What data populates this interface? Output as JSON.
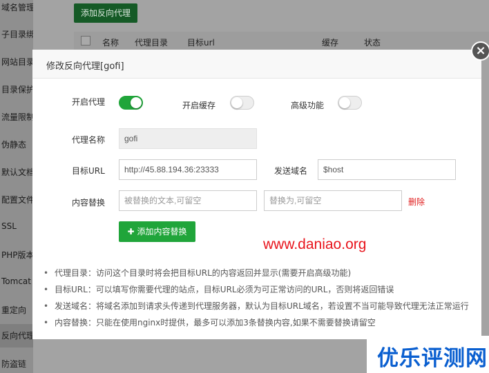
{
  "sidebar": {
    "items": [
      {
        "label": "域名管理"
      },
      {
        "label": "子目录绑定"
      },
      {
        "label": "网站目录"
      },
      {
        "label": "目录保护"
      },
      {
        "label": "流量限制"
      },
      {
        "label": "伪静态"
      },
      {
        "label": "默认文档"
      },
      {
        "label": "配置文件"
      },
      {
        "label": "SSL"
      },
      {
        "label": "PHP版本"
      },
      {
        "label": "Tomcat"
      },
      {
        "label": "重定向"
      },
      {
        "label": "反向代理"
      },
      {
        "label": "防盗链"
      }
    ]
  },
  "background": {
    "add_button_label": "添加反向代理",
    "table_headers": [
      "名称",
      "代理目录",
      "目标url",
      "缓存",
      "状态"
    ]
  },
  "modal": {
    "title": "修改反向代理[gofi]",
    "close_icon": "×",
    "toggles": {
      "enable_proxy": {
        "label": "开启代理",
        "on": true
      },
      "enable_cache": {
        "label": "开启缓存",
        "on": false
      },
      "advanced": {
        "label": "高级功能",
        "on": false
      }
    },
    "proxy_name": {
      "label": "代理名称",
      "value": "gofi"
    },
    "target_url": {
      "label": "目标URL",
      "value": "http://45.88.194.36:23333"
    },
    "send_domain": {
      "label": "发送域名",
      "value": "$host"
    },
    "content_replace": {
      "label": "内容替换",
      "find_placeholder": "被替换的文本,可留空",
      "replace_placeholder": "替换为,可留空",
      "delete_label": "删除"
    },
    "add_replace_button": {
      "plus": "✚",
      "label": "添加内容替换"
    },
    "notes": [
      "代理目录：访问这个目录时将会把目标URL的内容返回并显示(需要开启高级功能)",
      "目标URL：可以填写你需要代理的站点，目标URL必须为可正常访问的URL，否则将返回错误",
      "发送域名：将域名添加到请求头传递到代理服务器，默认为目标URL域名，若设置不当可能导致代理无法正常运行",
      "内容替换：只能在使用nginx时提供，最多可以添加3条替换内容,如果不需要替换请留空"
    ]
  },
  "watermark": "www.daniao.org",
  "brand": "优乐评测网",
  "colors": {
    "accent": "#20a53a",
    "delete": "#e02020",
    "brand": "#0a5fd0",
    "watermark": "#e8141c"
  }
}
